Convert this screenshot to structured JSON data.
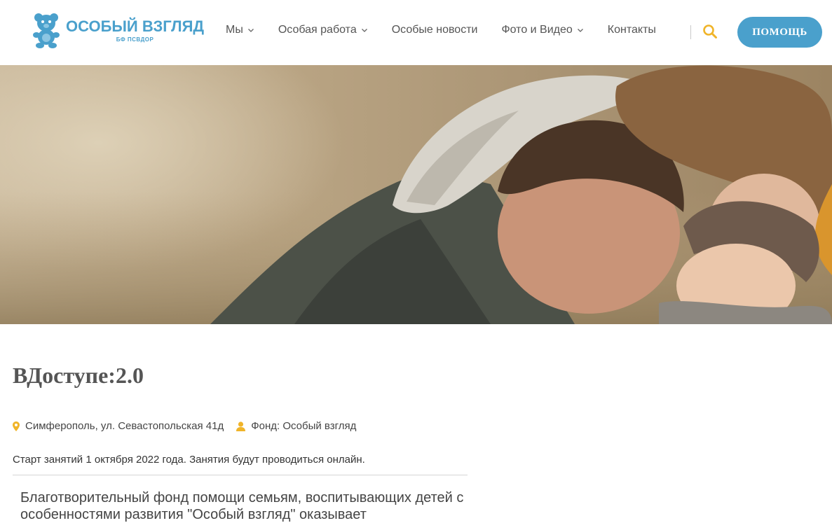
{
  "header": {
    "logo_title": "ОСОБЫЙ ВЗГЛЯД",
    "logo_sub": "БФ ПСВДОР",
    "nav": [
      {
        "label": "Мы",
        "dropdown": true
      },
      {
        "label": "Особая работа",
        "dropdown": true
      },
      {
        "label": "Особые новости",
        "dropdown": false
      },
      {
        "label": "Фото и Видео",
        "dropdown": true
      },
      {
        "label": "Контакты",
        "dropdown": false
      }
    ],
    "help_label": "ПОМОЩЬ"
  },
  "hero": {
    "icon": "family-photo"
  },
  "content": {
    "title": "ВДоступе:2.0",
    "location": "Симферополь, ул. Севастопольская 41д",
    "organizer": "Фонд: Особый взгляд",
    "description": "Старт занятий 1 октября 2022 года. Занятия будут проводиться онлайн.",
    "body": "Благотворительный фонд помощи семьям, воспитывающих детей с особенностями развития \"Особый взгляд\" оказывает"
  },
  "colors": {
    "brand": "#4aa0cc",
    "accent": "#f0b429",
    "text": "#444444"
  }
}
